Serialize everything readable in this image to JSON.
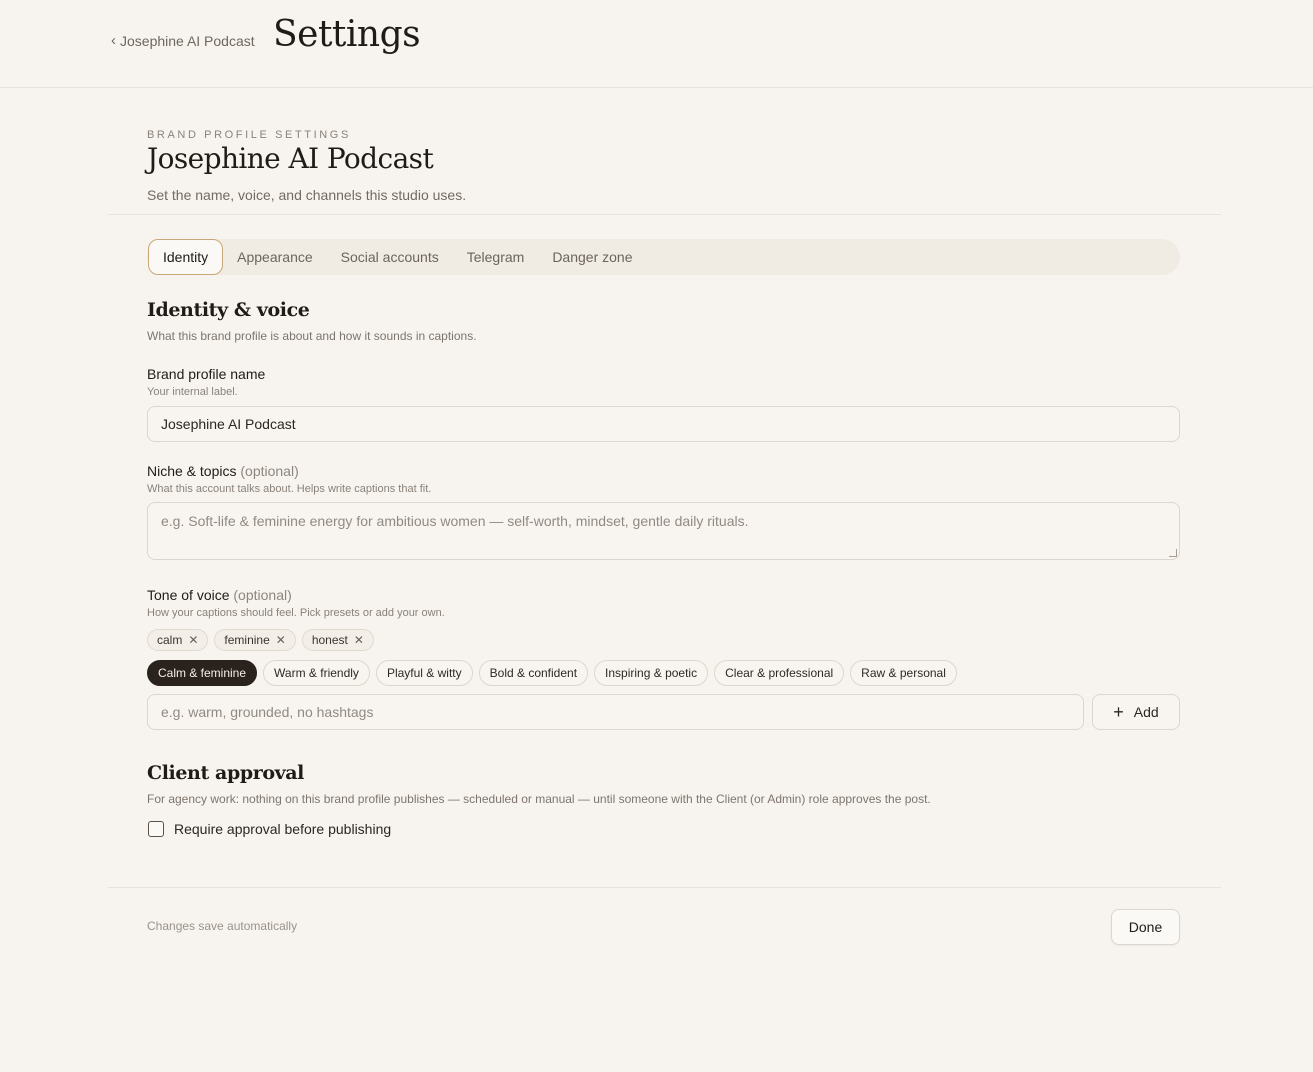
{
  "header": {
    "back_label": "Josephine AI Podcast",
    "title": "Settings"
  },
  "profile": {
    "eyebrow": "BRAND PROFILE SETTINGS",
    "name": "Josephine AI Podcast",
    "subtitle": "Set the name, voice, and channels this studio uses."
  },
  "tabs": [
    {
      "label": "Identity"
    },
    {
      "label": "Appearance"
    },
    {
      "label": "Social accounts"
    },
    {
      "label": "Telegram"
    },
    {
      "label": "Danger zone"
    }
  ],
  "identity": {
    "title": "Identity & voice",
    "desc": "What this brand profile is about and how it sounds in captions.",
    "name_label": "Brand profile name",
    "name_hint": "Your internal label.",
    "name_value": "Josephine AI Podcast",
    "niche_label": "Niche & topics",
    "niche_optional": "(optional)",
    "niche_hint": "What this account talks about. Helps write captions that fit.",
    "niche_placeholder": "e.g. Soft-life & feminine energy for ambitious women — self-worth, mindset, gentle daily rituals.",
    "tone_label": "Tone of voice",
    "tone_optional": "(optional)",
    "tone_hint": "How your captions should feel. Pick presets or add your own.",
    "tone_chips": [
      "calm",
      "feminine",
      "honest"
    ],
    "tone_presets": [
      "Calm & feminine",
      "Warm & friendly",
      "Playful & witty",
      "Bold & confident",
      "Inspiring & poetic",
      "Clear & professional",
      "Raw & personal"
    ],
    "tone_input_placeholder": "e.g. warm, grounded, no hashtags",
    "add_label": "Add"
  },
  "approval": {
    "title": "Client approval",
    "desc": "For agency work: nothing on this brand profile publishes — scheduled or manual — until someone with the Client (or Admin) role approves the post.",
    "checkbox_label": "Require approval before publishing"
  },
  "footer": {
    "note": "Changes save automatically",
    "done_label": "Done"
  }
}
